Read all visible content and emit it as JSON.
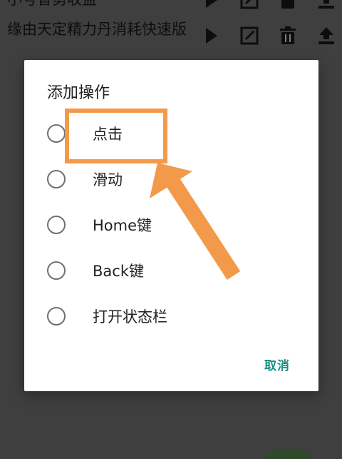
{
  "background": {
    "items": [
      {
        "name": "小号智勇收益"
      },
      {
        "name": "缘由天定精力丹消耗快速版"
      }
    ],
    "action_icons": [
      "play-icon",
      "edit-icon",
      "delete-icon",
      "upload-icon"
    ],
    "icon_color": "#1a1a1a"
  },
  "dialog": {
    "title": "添加操作",
    "options": [
      {
        "label": "点击"
      },
      {
        "label": "滑动"
      },
      {
        "label": "Home键"
      },
      {
        "label": "Back键"
      },
      {
        "label": "打开状态栏"
      }
    ],
    "cancel_label": "取消"
  },
  "annotation": {
    "highlight_color": "#f39a4a",
    "target": "点击"
  },
  "colors": {
    "accent": "#13907f",
    "overlay": "rgba(0,0,0,0.5)",
    "dialog_bg": "#ffffff"
  }
}
